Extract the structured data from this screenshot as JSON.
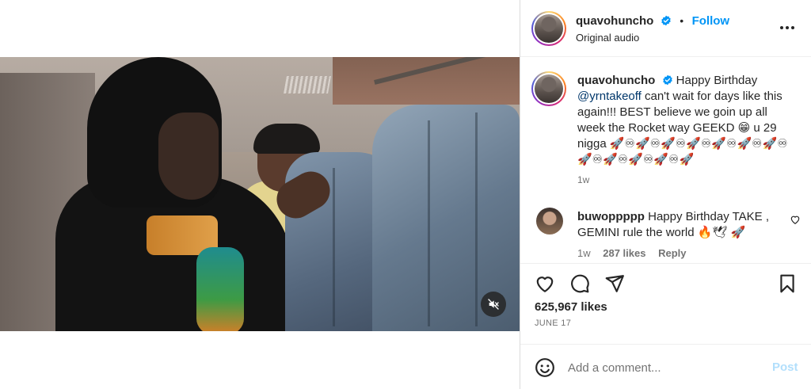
{
  "post": {
    "author": "quavohuncho",
    "follow_label": "Follow",
    "separator": "•",
    "audio": "Original audio"
  },
  "caption": {
    "author": "quavohuncho",
    "text_before_mention": " Happy Birthday ",
    "mention": "@yrntakeoff",
    "text_after": " can't wait for days like this again!!! BEST believe we goin up all week the Rocket way GEEKD 😁 u 29 nigga 🚀♾🚀♾🚀♾🚀♾🚀♾🚀♾🚀♾🚀♾🚀♾🚀♾🚀♾🚀",
    "time": "1w"
  },
  "comment": {
    "author": "buwoppppp",
    "text": " Happy Birthday TAKE , GEMINI rule the world 🔥🕊 🚀",
    "time": "1w",
    "likes": "287 likes",
    "reply": "Reply"
  },
  "stats": {
    "likes": "625,967 likes",
    "date": "JUNE 17"
  },
  "add_comment": {
    "placeholder": "Add a comment...",
    "post_label": "Post"
  },
  "colors": {
    "accent": "#0095f6",
    "post_disabled": "#b2dffc",
    "verified": "#0095f6"
  },
  "icons": [
    "verified-badge-icon",
    "more-options-icon",
    "heart-icon",
    "comment-icon",
    "share-icon",
    "bookmark-icon",
    "emoji-icon",
    "mute-icon"
  ]
}
